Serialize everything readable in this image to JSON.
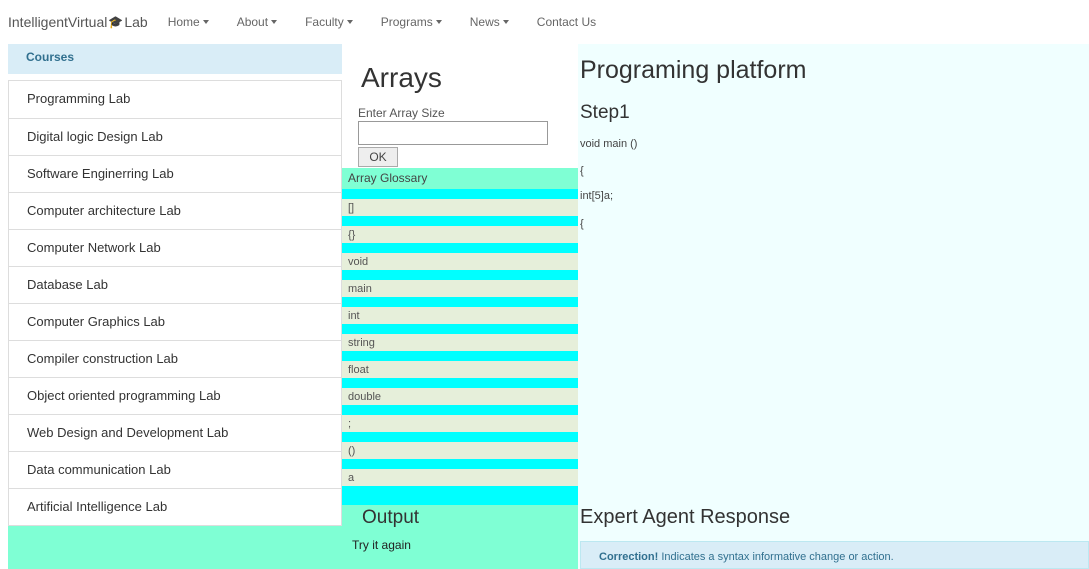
{
  "navbar": {
    "brand_left": "IntelligentVirtual",
    "brand_icon": "graduation-cap-icon",
    "brand_right": "Lab",
    "items": [
      {
        "label": "Home",
        "dropdown": true
      },
      {
        "label": "About",
        "dropdown": true
      },
      {
        "label": "Faculty",
        "dropdown": true
      },
      {
        "label": "Programs",
        "dropdown": true
      },
      {
        "label": "News",
        "dropdown": true
      },
      {
        "label": "Contact Us",
        "dropdown": false
      }
    ]
  },
  "sidebar": {
    "heading": "Courses",
    "items": [
      {
        "label": "Programming Lab"
      },
      {
        "label": "Digital logic Design Lab"
      },
      {
        "label": "Software Enginerring Lab"
      },
      {
        "label": "Computer architecture Lab"
      },
      {
        "label": "Computer Network Lab"
      },
      {
        "label": "Database Lab"
      },
      {
        "label": "Computer Graphics Lab"
      },
      {
        "label": "Compiler construction Lab"
      },
      {
        "label": "Object oriented programming Lab"
      },
      {
        "label": "Web Design and Development Lab"
      },
      {
        "label": "Data communication Lab"
      },
      {
        "label": "Artificial Intelligence Lab"
      }
    ]
  },
  "arrays": {
    "title": "Arrays",
    "size_label": "Enter Array Size",
    "size_value": "",
    "ok_label": "OK",
    "glossary_title": "Array Glossary",
    "glossary": [
      "[]",
      "{}",
      "void",
      "main",
      "int",
      "string",
      "float",
      "double",
      ";",
      "()",
      "a"
    ]
  },
  "output": {
    "title": "Output",
    "text": "Try it again"
  },
  "platform": {
    "title": "Programing platform",
    "step": "Step1",
    "code": [
      "void main ()",
      "{",
      "int[5]a;",
      "{"
    ]
  },
  "expert": {
    "title": "Expert Agent Response",
    "alert_strong": "Correction!",
    "alert_text": " Indicates a syntax informative change or action."
  },
  "colors": {
    "aquamarine": "#7fffd4",
    "cyan": "#00ffff",
    "azure": "#f0ffff",
    "info_bg": "#d9edf7",
    "info_text": "#31708f"
  }
}
